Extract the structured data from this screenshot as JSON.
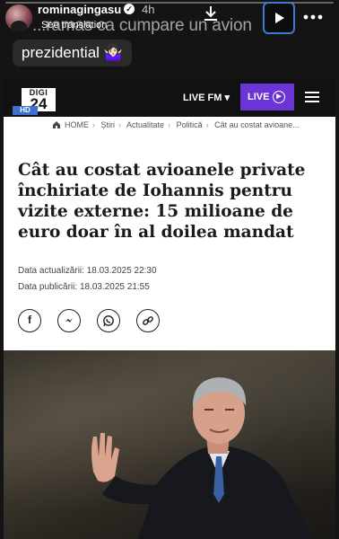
{
  "story": {
    "username": "rominagingasu",
    "time": "4h",
    "overlay_text": "...ramas ca cumpare un avion",
    "see_translation": "See translation",
    "caption": "prezidential 🤷🏻‍♀️",
    "icons": [
      "download-icon",
      "play-icon",
      "more-icon"
    ]
  },
  "site": {
    "logo_top": "DIGI",
    "logo_num": "24",
    "logo_hd": "HD",
    "livefm": "LIVE FM ▾",
    "live": "LIVE",
    "accent": "#6a34d6"
  },
  "article": {
    "breadcrumb": [
      "HOME",
      "Știri",
      "Actualitate",
      "Politică",
      "Cât au costat avioane..."
    ],
    "headline": "Cât au costat avioanele private închiriate de Iohannis pentru vizite externe: 15 milioane de euro doar în al doilea mandat",
    "updated_label": "Data actualizării:",
    "updated_value": "18.03.2025 22:30",
    "published_label": "Data publicării:",
    "published_value": "18.03.2025 21:55",
    "share": [
      "facebook-icon",
      "messenger-icon",
      "whatsapp-icon",
      "link-icon"
    ]
  }
}
